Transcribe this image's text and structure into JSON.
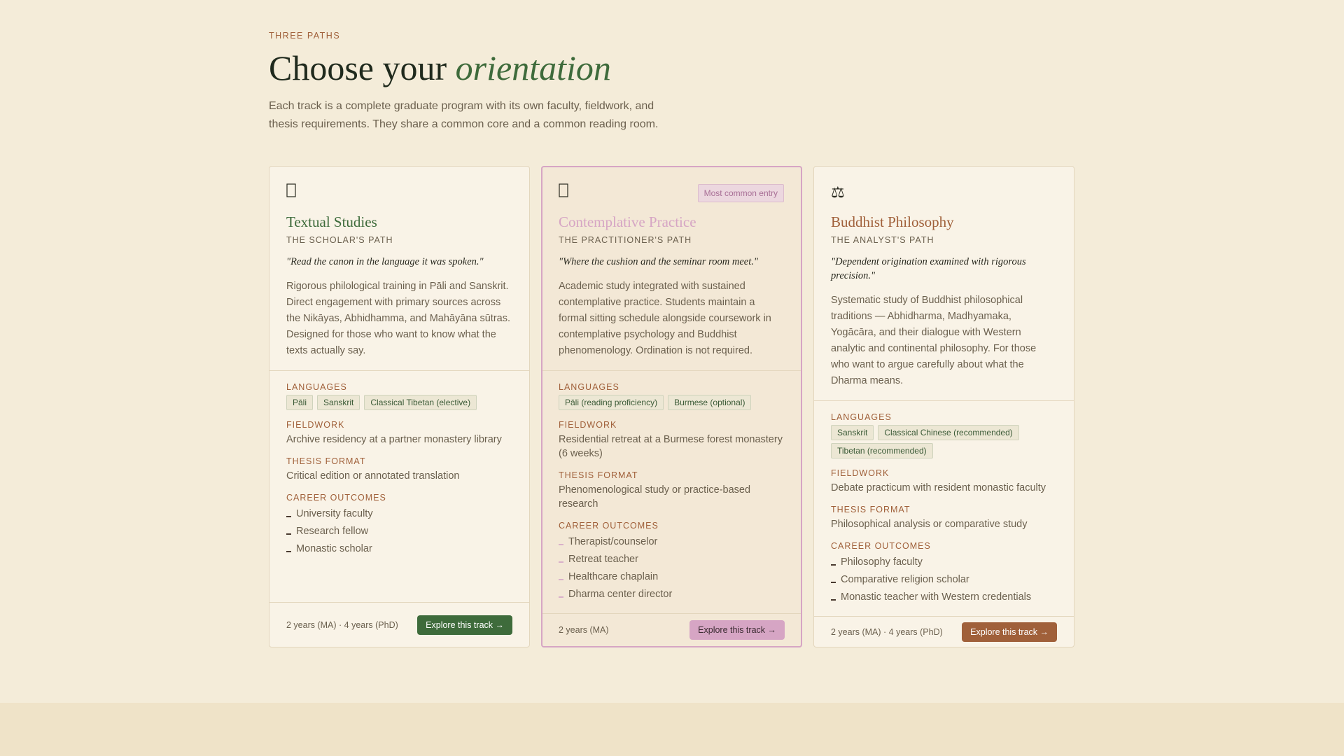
{
  "header": {
    "eyebrow": "THREE PATHS",
    "title_plain": "Choose your ",
    "title_emphasis": "orientation",
    "lede": "Each track is a complete graduate program with its own faculty, fieldwork, and thesis requirements. They share a common core and a common reading room."
  },
  "colors": {
    "page_bg": "#f4ecd9",
    "textual_accent": "#3e6b3b",
    "contemplative_accent": "#d6a5c4",
    "philosophy_accent": "#a0603a"
  },
  "tracks": [
    {
      "icon": "book-icon",
      "badge": "",
      "name": "Textual Studies",
      "subtitle": "THE SCHOLAR'S PATH",
      "quote": "\"Read the canon in the language it was spoken.\"",
      "description": "Rigorous philological training in Pāli and Sanskrit. Direct engagement with primary sources across the Nikāyas, Abhidhamma, and Mahāyāna sūtras. Designed for those who want to know what the texts actually say.",
      "languages_label": "LANGUAGES",
      "languages": [
        "Pāli",
        "Sanskrit",
        "Classical Tibetan (elective)"
      ],
      "fieldwork_label": "FIELDWORK",
      "fieldwork": "Archive residency at a partner monastery library",
      "thesis_label": "THESIS FORMAT",
      "thesis": "Critical edition or annotated translation",
      "careers_label": "CAREER OUTCOMES",
      "careers": [
        "University faculty",
        "Research fellow",
        "Monastic scholar"
      ],
      "duration": "2 years (MA) · 4 years (PhD)",
      "cta": "Explore this track →"
    },
    {
      "icon": "meditation-icon",
      "badge": "Most common entry",
      "name": "Contemplative Practice",
      "subtitle": "THE PRACTITIONER'S PATH",
      "quote": "\"Where the cushion and the seminar room meet.\"",
      "description": "Academic study integrated with sustained contemplative practice. Students maintain a formal sitting schedule alongside coursework in contemplative psychology and Buddhist phenomenology. Ordination is not required.",
      "languages_label": "LANGUAGES",
      "languages": [
        "Pāli (reading proficiency)",
        "Burmese (optional)"
      ],
      "fieldwork_label": "FIELDWORK",
      "fieldwork": "Residential retreat at a Burmese forest monastery (6 weeks)",
      "thesis_label": "THESIS FORMAT",
      "thesis": "Phenomenological study or practice-based research",
      "careers_label": "CAREER OUTCOMES",
      "careers": [
        "Therapist/counselor",
        "Retreat teacher",
        "Healthcare chaplain",
        "Dharma center director"
      ],
      "duration": "2 years (MA)",
      "cta": "Explore this track →"
    },
    {
      "icon": "balance-scale-icon",
      "badge": "",
      "name": "Buddhist Philosophy",
      "subtitle": "THE ANALYST'S PATH",
      "quote": "\"Dependent origination examined with rigorous precision.\"",
      "description": "Systematic study of Buddhist philosophical traditions — Abhidharma, Madhyamaka, Yogācāra, and their dialogue with Western analytic and continental philosophy. For those who want to argue carefully about what the Dharma means.",
      "languages_label": "LANGUAGES",
      "languages": [
        "Sanskrit",
        "Classical Chinese (recommended)",
        "Tibetan (recommended)"
      ],
      "fieldwork_label": "FIELDWORK",
      "fieldwork": "Debate practicum with resident monastic faculty",
      "thesis_label": "THESIS FORMAT",
      "thesis": "Philosophical analysis or comparative study",
      "careers_label": "CAREER OUTCOMES",
      "careers": [
        "Philosophy faculty",
        "Comparative religion scholar",
        "Monastic teacher with Western credentials"
      ],
      "duration": "2 years (MA) · 4 years (PhD)",
      "cta": "Explore this track →"
    }
  ]
}
